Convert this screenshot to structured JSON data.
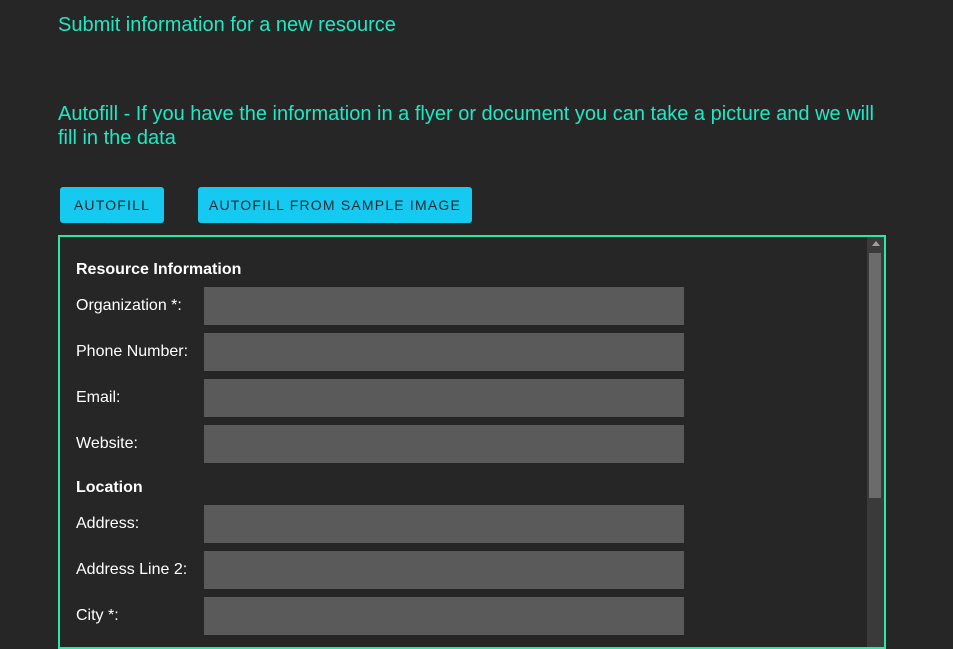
{
  "page": {
    "title": "Submit information for a new resource",
    "autofill_description": "Autofill - If you have the information in a flyer or document you can take a picture and we will fill in the data"
  },
  "buttons": {
    "autofill": "AUTOFILL",
    "autofill_sample": "AUTOFILL FROM SAMPLE IMAGE"
  },
  "form": {
    "resource_section": {
      "heading": "Resource Information",
      "fields": [
        {
          "label": "Organization *:",
          "value": ""
        },
        {
          "label": "Phone Number:",
          "value": ""
        },
        {
          "label": "Email:",
          "value": ""
        },
        {
          "label": "Website:",
          "value": ""
        }
      ]
    },
    "location_section": {
      "heading": "Location",
      "fields": [
        {
          "label": "Address:",
          "value": ""
        },
        {
          "label": "Address Line 2:",
          "value": ""
        },
        {
          "label": "City *:",
          "value": ""
        }
      ]
    }
  },
  "colors": {
    "accent_text": "#1de9c4",
    "button_bg": "#15c9f0",
    "panel_border": "#2ee6a6",
    "background": "#262626",
    "input_bg": "#5a5a5a"
  }
}
